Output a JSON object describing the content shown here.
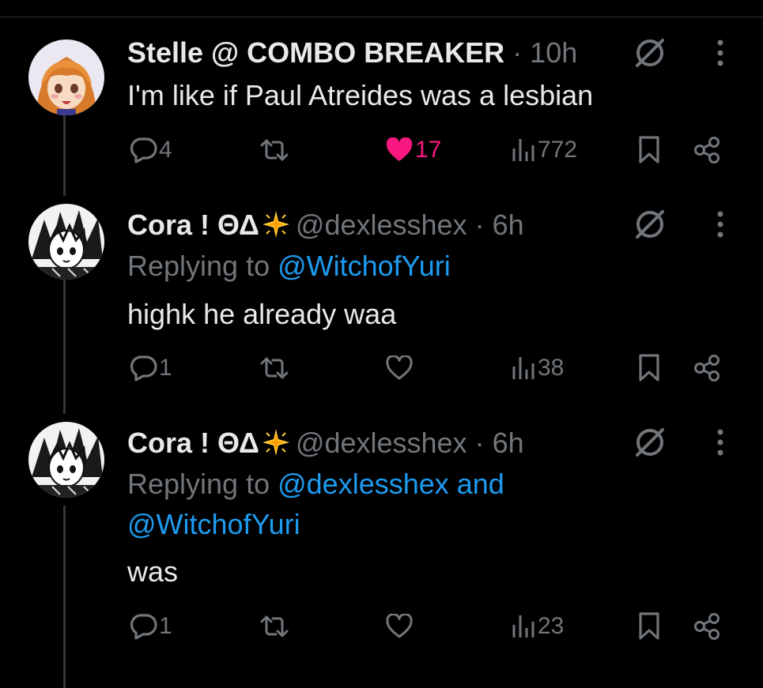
{
  "colors": {
    "background": "#000000",
    "text_primary": "#e7e9ea",
    "text_muted": "#71767b",
    "mention": "#1d9bf0",
    "like_active": "#f91880",
    "thread_line": "#333639"
  },
  "tweets": [
    {
      "author_name": "Stelle @ COMBO BREAKER",
      "handle": "",
      "separator": " · ",
      "time": "10h",
      "replying_prefix": "",
      "replying_mentions": [],
      "text": "I'm like if Paul Atreides was a lesbian",
      "actions": {
        "reply_icon": "reply-icon",
        "reply_count": "4",
        "retweet_icon": "retweet-icon",
        "retweet_count": "",
        "like_icon": "heart-filled-icon",
        "like_count": "17",
        "liked": true,
        "views_icon": "views-icon",
        "views_count": "772",
        "bookmark_icon": "bookmark-icon",
        "share_icon": "share-icon"
      }
    },
    {
      "author_name": "Cora ! ΘΔ",
      "handle": "@dexlesshex",
      "separator": " · ",
      "time": "6h",
      "replying_prefix": "Replying to ",
      "replying_mentions": [
        "@WitchofYuri"
      ],
      "text": "highk he already waa",
      "actions": {
        "reply_icon": "reply-icon",
        "reply_count": "1",
        "retweet_icon": "retweet-icon",
        "retweet_count": "",
        "like_icon": "heart-outline-icon",
        "like_count": "",
        "liked": false,
        "views_icon": "views-icon",
        "views_count": "38",
        "bookmark_icon": "bookmark-icon",
        "share_icon": "share-icon"
      }
    },
    {
      "author_name": "Cora ! ΘΔ",
      "handle": "@dexlesshex",
      "separator": " · ",
      "time": "6h",
      "replying_prefix": "Replying to ",
      "replying_line1_mention": "@dexlesshex and",
      "replying_line2_mention": "@WitchofYuri",
      "text": "was",
      "actions": {
        "reply_icon": "reply-icon",
        "reply_count": "1",
        "retweet_icon": "retweet-icon",
        "retweet_count": "",
        "like_icon": "heart-outline-icon",
        "like_count": "",
        "liked": false,
        "views_icon": "views-icon",
        "views_count": "23",
        "bookmark_icon": "bookmark-icon",
        "share_icon": "share-icon"
      }
    }
  ]
}
